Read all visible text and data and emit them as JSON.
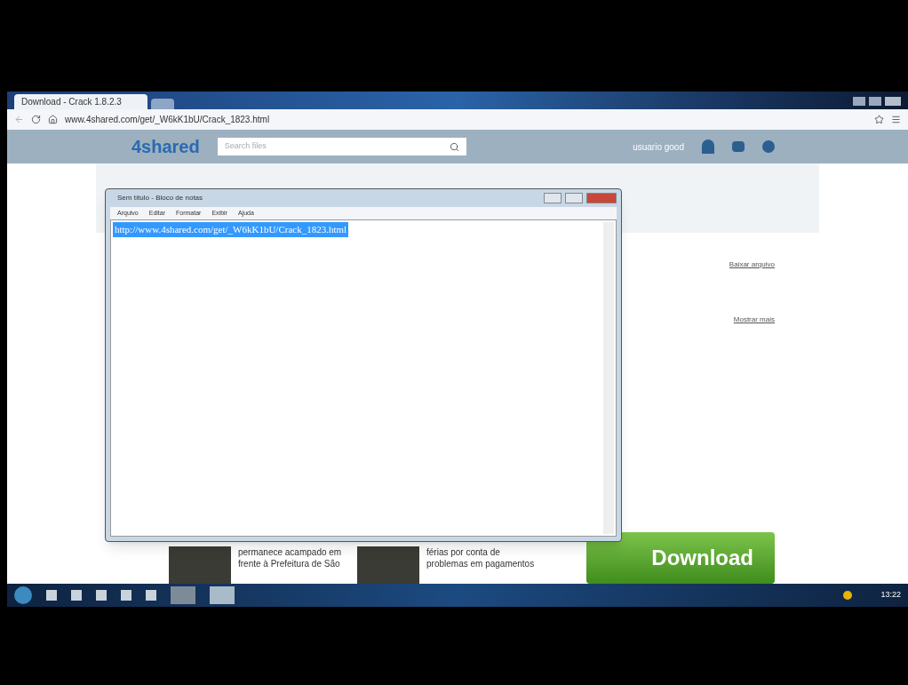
{
  "browser": {
    "tab": {
      "title": "Download - Crack 1.8.2.3",
      "selected": true
    },
    "url": "www.4shared.com/get/_W6kK1bU/Crack_1823.html"
  },
  "site_header": {
    "logo": "4shared",
    "search": {
      "placeholder": "Search files"
    },
    "user": "usuario good"
  },
  "page": {
    "links": [
      "Baixar arquivo",
      "Mostrar mais"
    ],
    "news": [
      {
        "text": "permanece acampado em frente à Prefeitura de São"
      },
      {
        "text": "férias por conta de problemas em pagamentos"
      }
    ],
    "download_button": "Download"
  },
  "notepad": {
    "title": "Sem título - Bloco de notas",
    "menu": [
      "Arquivo",
      "Editar",
      "Formatar",
      "Exibir",
      "Ajuda"
    ],
    "selected_text": "http://www.4shared.com/get/_W6kK1bU/Crack_1823.html"
  },
  "taskbar": {
    "clock": "13:22"
  }
}
